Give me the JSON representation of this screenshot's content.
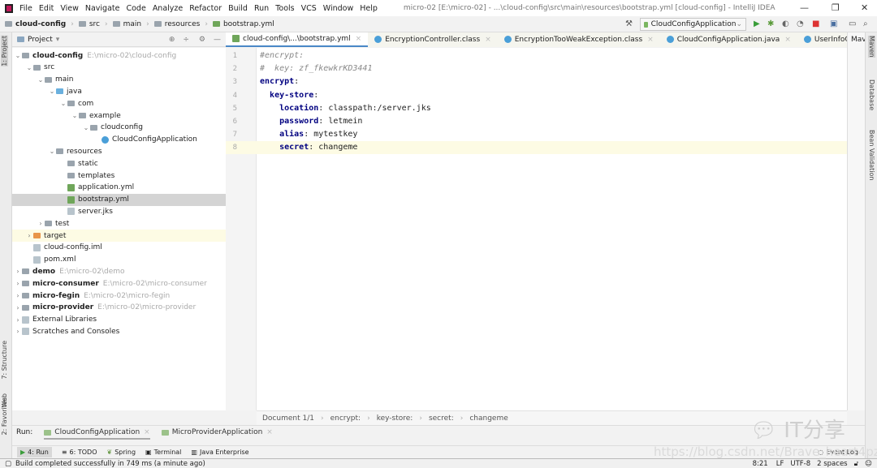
{
  "menu": [
    "File",
    "Edit",
    "View",
    "Navigate",
    "Code",
    "Analyze",
    "Refactor",
    "Build",
    "Run",
    "Tools",
    "VCS",
    "Window",
    "Help"
  ],
  "window_title": "micro-02 [E:\\micro-02] - ...\\cloud-config\\src\\main\\resources\\bootstrap.yml [cloud-config] - IntelliJ IDEA",
  "breadcrumbs": [
    "cloud-config",
    "src",
    "main",
    "resources",
    "bootstrap.yml"
  ],
  "run_config": "CloudConfigApplication",
  "left_tabs": [
    "1: Project",
    "7: Structure",
    "Web",
    "2: Favorites"
  ],
  "right_tabs": [
    "Maven",
    "Database",
    "Bean Validation"
  ],
  "project_panel": {
    "title": "Project"
  },
  "tree": [
    {
      "label": "cloud-config",
      "path": "E:\\micro-02\\cloud-config",
      "depth": 0,
      "arrow": "v",
      "bold": true
    },
    {
      "label": "src",
      "depth": 1,
      "arrow": "v"
    },
    {
      "label": "main",
      "depth": 2,
      "arrow": "v"
    },
    {
      "label": "java",
      "depth": 3,
      "arrow": "v"
    },
    {
      "label": "com",
      "depth": 4,
      "arrow": "v"
    },
    {
      "label": "example",
      "depth": 5,
      "arrow": "v"
    },
    {
      "label": "cloudconfig",
      "depth": 6,
      "arrow": "v"
    },
    {
      "label": "CloudConfigApplication",
      "depth": 7,
      "arrow": ""
    },
    {
      "label": "resources",
      "depth": 3,
      "arrow": "v"
    },
    {
      "label": "static",
      "depth": 4,
      "arrow": ""
    },
    {
      "label": "templates",
      "depth": 4,
      "arrow": ""
    },
    {
      "label": "application.yml",
      "depth": 4,
      "arrow": ""
    },
    {
      "label": "bootstrap.yml",
      "depth": 4,
      "arrow": "",
      "selected": true
    },
    {
      "label": "server.jks",
      "depth": 4,
      "arrow": ""
    },
    {
      "label": "test",
      "depth": 2,
      "arrow": ">"
    },
    {
      "label": "target",
      "depth": 1,
      "arrow": ">",
      "highlight": true
    },
    {
      "label": "cloud-config.iml",
      "depth": 1,
      "arrow": ""
    },
    {
      "label": "pom.xml",
      "depth": 1,
      "arrow": ""
    },
    {
      "label": "demo",
      "path": "E:\\micro-02\\demo",
      "depth": 0,
      "arrow": ">",
      "bold": true
    },
    {
      "label": "micro-consumer",
      "path": "E:\\micro-02\\micro-consumer",
      "depth": 0,
      "arrow": ">",
      "bold": true
    },
    {
      "label": "micro-fegin",
      "path": "E:\\micro-02\\micro-fegin",
      "depth": 0,
      "arrow": ">",
      "bold": true
    },
    {
      "label": "micro-provider",
      "path": "E:\\micro-02\\micro-provider",
      "depth": 0,
      "arrow": ">",
      "bold": true
    },
    {
      "label": "External Libraries",
      "depth": 0,
      "arrow": ">"
    },
    {
      "label": "Scratches and Consoles",
      "depth": 0,
      "arrow": ">"
    }
  ],
  "editor_tabs": [
    "cloud-config\\...\\bootstrap.yml",
    "EncryptionController.class",
    "EncryptionTooWeakException.class",
    "CloudConfigApplication.java",
    "UserInfoController.j"
  ],
  "more_tabs": "+≡4",
  "maven_label": "Mav",
  "code": [
    {
      "n": "1",
      "cm": "#encrypt:"
    },
    {
      "n": "2",
      "cm": "#  key: zf_fkewkrKD3441"
    },
    {
      "n": "3",
      "indent": "",
      "key": "encrypt",
      "val": ""
    },
    {
      "n": "4",
      "indent": "  ",
      "key": "key-store",
      "val": ""
    },
    {
      "n": "5",
      "indent": "    ",
      "key": "location",
      "val": "classpath:/server.jks"
    },
    {
      "n": "6",
      "indent": "    ",
      "key": "password",
      "val": "letmein"
    },
    {
      "n": "7",
      "indent": "    ",
      "key": "alias",
      "val": "mytestkey"
    },
    {
      "n": "8",
      "indent": "    ",
      "key": "secret",
      "val": "changeme"
    }
  ],
  "editor_breadcrumb": [
    "Document 1/1",
    "encrypt:",
    "key-store:",
    "secret:",
    "changeme"
  ],
  "run": {
    "label": "Run:",
    "tabs": [
      "CloudConfigApplication",
      "MicroProviderApplication"
    ]
  },
  "bottom_tools": [
    "4: Run",
    "6: TODO",
    "Spring",
    "Terminal",
    "Java Enterprise"
  ],
  "event_log": "Event Log",
  "status": {
    "message": "Build completed successfully in 749 ms (a minute ago)",
    "position": "8:21",
    "line_sep": "LF",
    "encoding": "UTF-8",
    "indent": "2 spaces"
  },
  "watermark": {
    "brand": "IT分享",
    "url": "https://blog.csdn.net/Brave_heart4pzj"
  }
}
